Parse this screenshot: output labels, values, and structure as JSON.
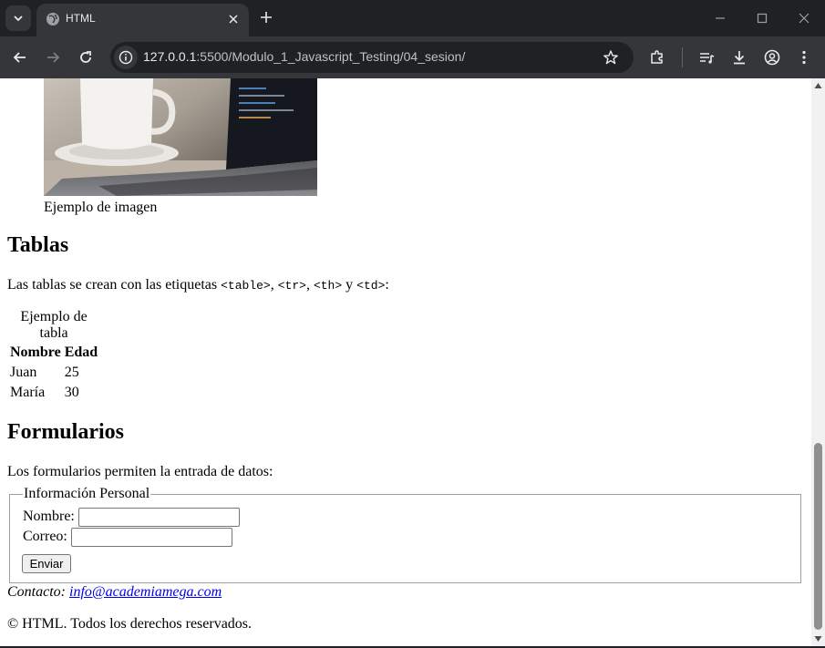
{
  "browser": {
    "tab_title": "HTML",
    "url_host": "127.0.0.1",
    "url_path": ":5500/Modulo_1_Javascript_Testing/04_sesion/"
  },
  "figure": {
    "caption": "Ejemplo de imagen"
  },
  "tables_section": {
    "heading": "Tablas",
    "intro_prefix": "Las tablas se crean con las etiquetas ",
    "tag_table": "<table>",
    "sep1": ", ",
    "tag_tr": "<tr>",
    "sep2": ", ",
    "tag_th": "<th>",
    "sep3": " y ",
    "tag_td": "<td>",
    "intro_suffix": ":",
    "table": {
      "caption": "Ejemplo de tabla",
      "headers": [
        "Nombre",
        "Edad"
      ],
      "rows": [
        [
          "Juan",
          "25"
        ],
        [
          "María",
          "30"
        ]
      ]
    }
  },
  "forms_section": {
    "heading": "Formularios",
    "intro": "Los formularios permiten la entrada de datos:",
    "legend": "Información Personal",
    "name_label": "Nombre:",
    "name_value": "",
    "email_label": "Correo:",
    "email_value": "",
    "submit_label": "Enviar"
  },
  "contact": {
    "label": "Contacto:",
    "email": "info@academiamega.com"
  },
  "footer": {
    "text": "© HTML. Todos los derechos reservados."
  },
  "colors": {
    "chrome_dark": "#202124",
    "chrome_toolbar": "#35363a",
    "link": "#0000ee"
  }
}
